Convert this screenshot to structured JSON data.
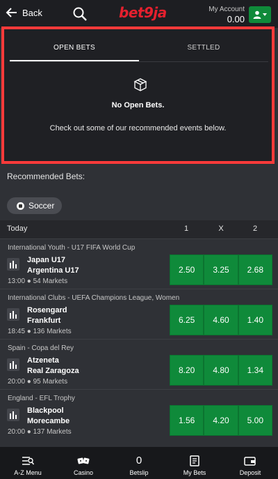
{
  "header": {
    "back_label": "Back",
    "logo_text": "bet9ja",
    "account_label": "My Account",
    "account_balance": "0.00"
  },
  "bets": {
    "tabs": [
      {
        "label": "OPEN BETS",
        "active": true
      },
      {
        "label": "SETTLED",
        "active": false
      }
    ],
    "empty_title": "No Open Bets.",
    "empty_message": "Check out some of our recommended events below."
  },
  "recommended": {
    "title": "Recommended Bets:",
    "sport_chip": "Soccer",
    "columns": {
      "day": "Today",
      "home": "1",
      "draw": "X",
      "away": "2"
    },
    "events": [
      {
        "league": "International Youth - U17 FIFA World Cup",
        "team1": "Japan U17",
        "team2": "Argentina U17",
        "meta": "13:00 ● 54 Markets",
        "odds": [
          "2.50",
          "3.25",
          "2.68"
        ]
      },
      {
        "league": "International Clubs - UEFA Champions League, Women",
        "team1": "Rosengard",
        "team2": "Frankfurt",
        "meta": "18:45 ● 136 Markets",
        "odds": [
          "6.25",
          "4.60",
          "1.40"
        ]
      },
      {
        "league": "Spain - Copa del Rey",
        "team1": "Atzeneta",
        "team2": "Real Zaragoza",
        "meta": "20:00 ● 95 Markets",
        "odds": [
          "8.20",
          "4.80",
          "1.34"
        ]
      },
      {
        "league": "England - EFL Trophy",
        "team1": "Blackpool",
        "team2": "Morecambe",
        "meta": "20:00 ● 137 Markets",
        "odds": [
          "1.56",
          "4.20",
          "5.00"
        ]
      }
    ]
  },
  "tabbar": {
    "items": [
      {
        "label": "A-Z Menu",
        "icon": "menu-icon"
      },
      {
        "label": "Casino",
        "icon": "casino-icon"
      },
      {
        "label": "Betslip",
        "count": "0"
      },
      {
        "label": "My Bets",
        "icon": "ticket-icon"
      },
      {
        "label": "Deposit",
        "icon": "wallet-icon"
      }
    ]
  },
  "colors": {
    "accent_green": "#0f8a3a",
    "brand_red": "#e5202e",
    "highlight": "#ff3a3a"
  }
}
